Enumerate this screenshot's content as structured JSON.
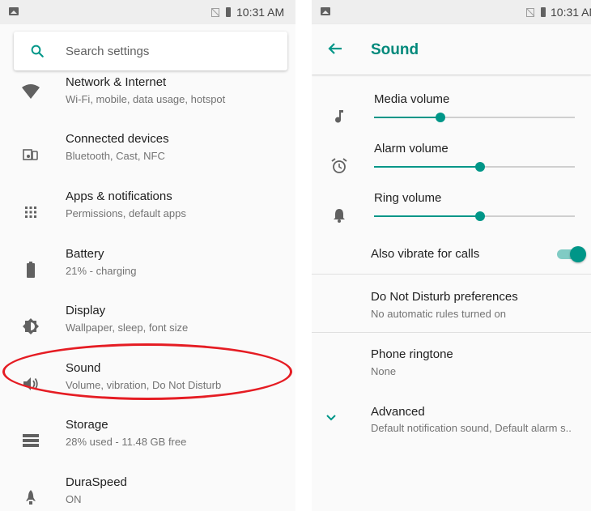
{
  "status_bar": {
    "time": "10:31 AM"
  },
  "settings": {
    "search_placeholder": "Search settings",
    "items": [
      {
        "title": "Network & Internet",
        "subtitle": "Wi-Fi, mobile, data usage, hotspot",
        "icon": "wifi-icon"
      },
      {
        "title": "Connected devices",
        "subtitle": "Bluetooth, Cast, NFC",
        "icon": "devices-icon"
      },
      {
        "title": "Apps & notifications",
        "subtitle": "Permissions, default apps",
        "icon": "apps-icon"
      },
      {
        "title": "Battery",
        "subtitle": "21% - charging",
        "icon": "battery-icon"
      },
      {
        "title": "Display",
        "subtitle": "Wallpaper, sleep, font size",
        "icon": "brightness-icon"
      },
      {
        "title": "Sound",
        "subtitle": "Volume, vibration, Do Not Disturb",
        "icon": "volume-icon"
      },
      {
        "title": "Storage",
        "subtitle": "28% used - 11.48 GB free",
        "icon": "storage-icon"
      },
      {
        "title": "DuraSpeed",
        "subtitle": "ON",
        "icon": "rocket-icon"
      }
    ],
    "highlighted_item": "Sound",
    "highlight_color": "#e51c23"
  },
  "sound": {
    "title": "Sound",
    "accent_color": "#009688",
    "volumes": [
      {
        "label": "Media volume",
        "level": 0.33,
        "icon": "music-note-icon"
      },
      {
        "label": "Alarm volume",
        "level": 0.53,
        "icon": "alarm-icon"
      },
      {
        "label": "Ring volume",
        "level": 0.53,
        "icon": "bell-icon"
      }
    ],
    "vibrate": {
      "label": "Also vibrate for calls",
      "on": true
    },
    "dnd": {
      "title": "Do Not Disturb preferences",
      "subtitle": "No automatic rules turned on"
    },
    "ringtone": {
      "title": "Phone ringtone",
      "subtitle": "None"
    },
    "advanced": {
      "title": "Advanced",
      "subtitle": "Default notification sound, Default alarm s.."
    }
  }
}
